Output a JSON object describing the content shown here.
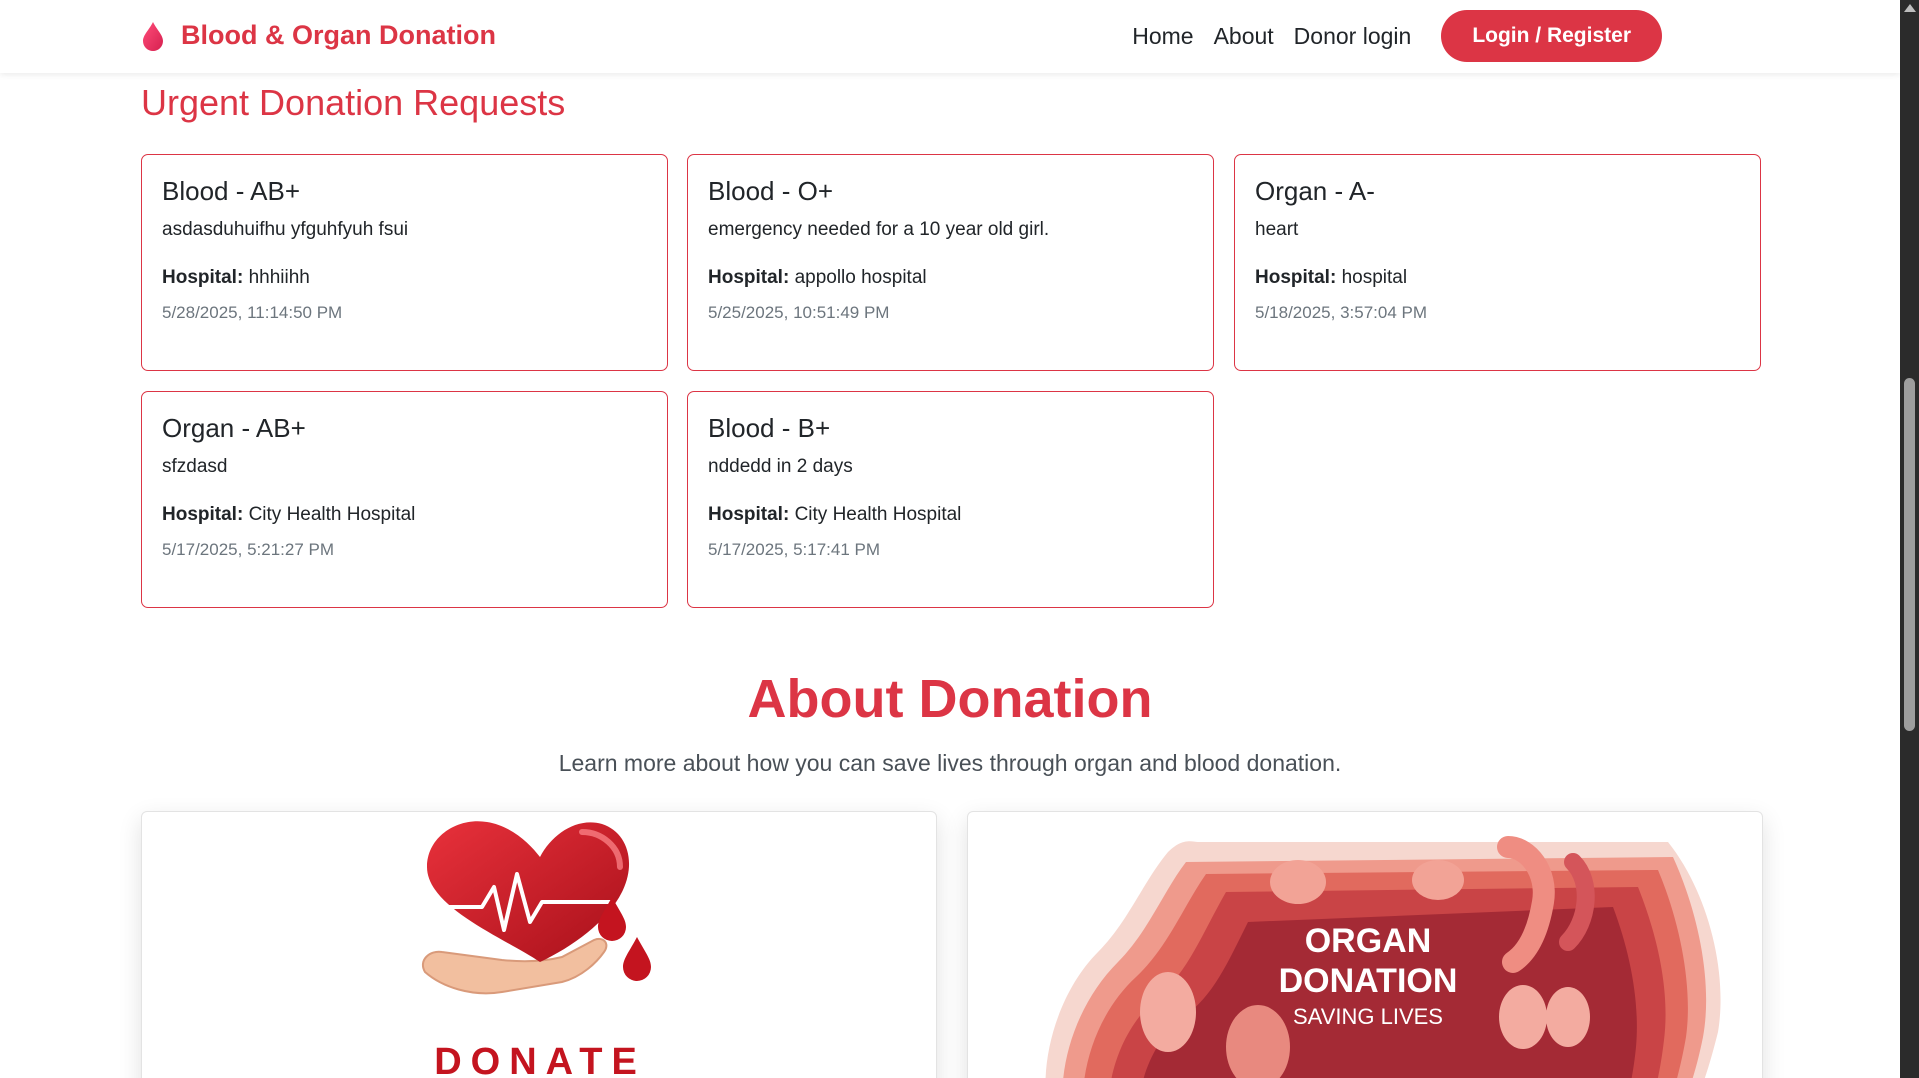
{
  "colors": {
    "accent": "#dc3545",
    "text": "#212529",
    "muted": "#6c757d"
  },
  "navbar": {
    "brand": "Blood & Organ Donation",
    "brand_icon": "blood-drop-icon",
    "links": [
      "Home",
      "About",
      "Donor login"
    ],
    "login_button": "Login / Register"
  },
  "requests": {
    "title": "Urgent Donation Requests",
    "hospital_label": "Hospital:",
    "items": [
      {
        "title": "Blood - AB+",
        "description": "asdasduhuifhu yfguhfyuh fsui",
        "hospital": "hhhiihh",
        "time": "5/28/2025, 11:14:50 PM"
      },
      {
        "title": "Blood - O+",
        "description": "emergency needed for a 10 year old girl.",
        "hospital": "appollo hospital",
        "time": "5/25/2025, 10:51:49 PM"
      },
      {
        "title": "Organ - A-",
        "description": "heart",
        "hospital": "hospital",
        "time": "5/18/2025, 3:57:04 PM"
      },
      {
        "title": "Organ - AB+",
        "description": "sfzdasd",
        "hospital": "City Health Hospital",
        "time": "5/17/2025, 5:21:27 PM"
      },
      {
        "title": "Blood - B+",
        "description": "nddedd in 2 days",
        "hospital": "City Health Hospital",
        "time": "5/17/2025, 5:17:41 PM"
      }
    ]
  },
  "about": {
    "title": "About Donation",
    "subtitle": "Learn more about how you can save lives through organ and blood donation.",
    "cards": [
      {
        "image_icon": "heart-hand-donate-icon",
        "image_text": "DONATE"
      },
      {
        "image_icon": "organ-donation-illustration",
        "image_text_1": "ORGAN",
        "image_text_2": "DONATION",
        "image_text_3": "SAVING LIVES"
      }
    ]
  }
}
